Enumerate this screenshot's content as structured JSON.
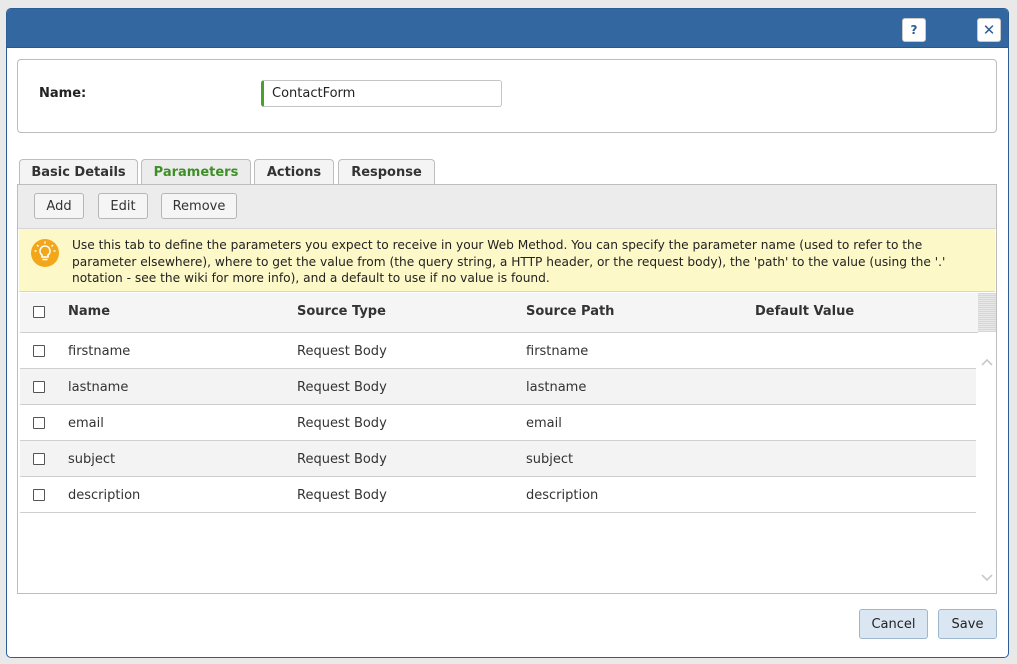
{
  "window": {
    "help_label": "?",
    "close_label": "✕"
  },
  "form": {
    "name_label": "Name:",
    "name_value": "ContactForm"
  },
  "tabs": [
    {
      "label": "Basic Details",
      "active": false
    },
    {
      "label": "Parameters",
      "active": true
    },
    {
      "label": "Actions",
      "active": false
    },
    {
      "label": "Response",
      "active": false
    }
  ],
  "toolbar": {
    "add_label": "Add",
    "edit_label": "Edit",
    "remove_label": "Remove"
  },
  "info": {
    "icon": "lightbulb-icon",
    "text": "Use this tab to define the parameters you expect to receive in your Web Method. You can specify the parameter name (used to refer to the parameter elsewhere), where to get the value from (the query string, a HTTP header, or the request body), the 'path' to the value (using the '.' notation - see the wiki for more info), and a default to use if no value is found."
  },
  "grid": {
    "columns": [
      "Name",
      "Source Type",
      "Source Path",
      "Default Value"
    ],
    "rows": [
      {
        "name": "firstname",
        "source_type": "Request Body",
        "source_path": "firstname",
        "default_value": ""
      },
      {
        "name": "lastname",
        "source_type": "Request Body",
        "source_path": "lastname",
        "default_value": ""
      },
      {
        "name": "email",
        "source_type": "Request Body",
        "source_path": "email",
        "default_value": ""
      },
      {
        "name": "subject",
        "source_type": "Request Body",
        "source_path": "subject",
        "default_value": ""
      },
      {
        "name": "description",
        "source_type": "Request Body",
        "source_path": "description",
        "default_value": ""
      }
    ]
  },
  "footer": {
    "cancel_label": "Cancel",
    "save_label": "Save"
  },
  "colors": {
    "titlebar": "#32679f",
    "active_tab_text": "#3f8f27",
    "info_background": "#fdf8c8",
    "bulb": "#f2a71b"
  }
}
